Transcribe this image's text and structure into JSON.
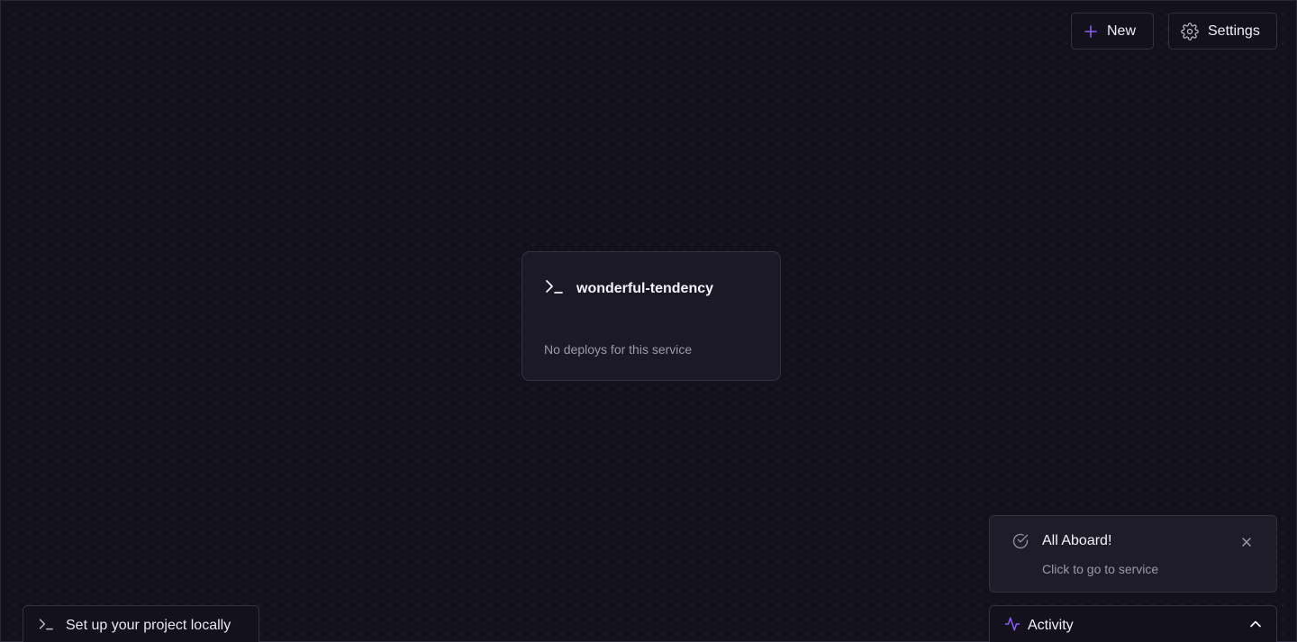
{
  "toolbar": {
    "new_label": "New",
    "new_icon": "plus-icon",
    "settings_label": "Settings",
    "settings_icon": "gear-icon"
  },
  "service": {
    "icon": "terminal-icon",
    "name": "wonderful-tendency",
    "status": "No deploys for this service"
  },
  "toast": {
    "icon": "check-circle-icon",
    "title": "All Aboard!",
    "body": "Click to go to service",
    "close_icon": "close-icon"
  },
  "activity": {
    "icon": "activity-pulse-icon",
    "label": "Activity",
    "toggle_icon": "chevron-up-icon"
  },
  "local_setup": {
    "icon": "terminal-icon",
    "label": "Set up your project locally"
  },
  "colors": {
    "background": "#13111c",
    "accent": "#8b5cf6",
    "border": "#34313f",
    "muted_text": "#9c99aa"
  }
}
